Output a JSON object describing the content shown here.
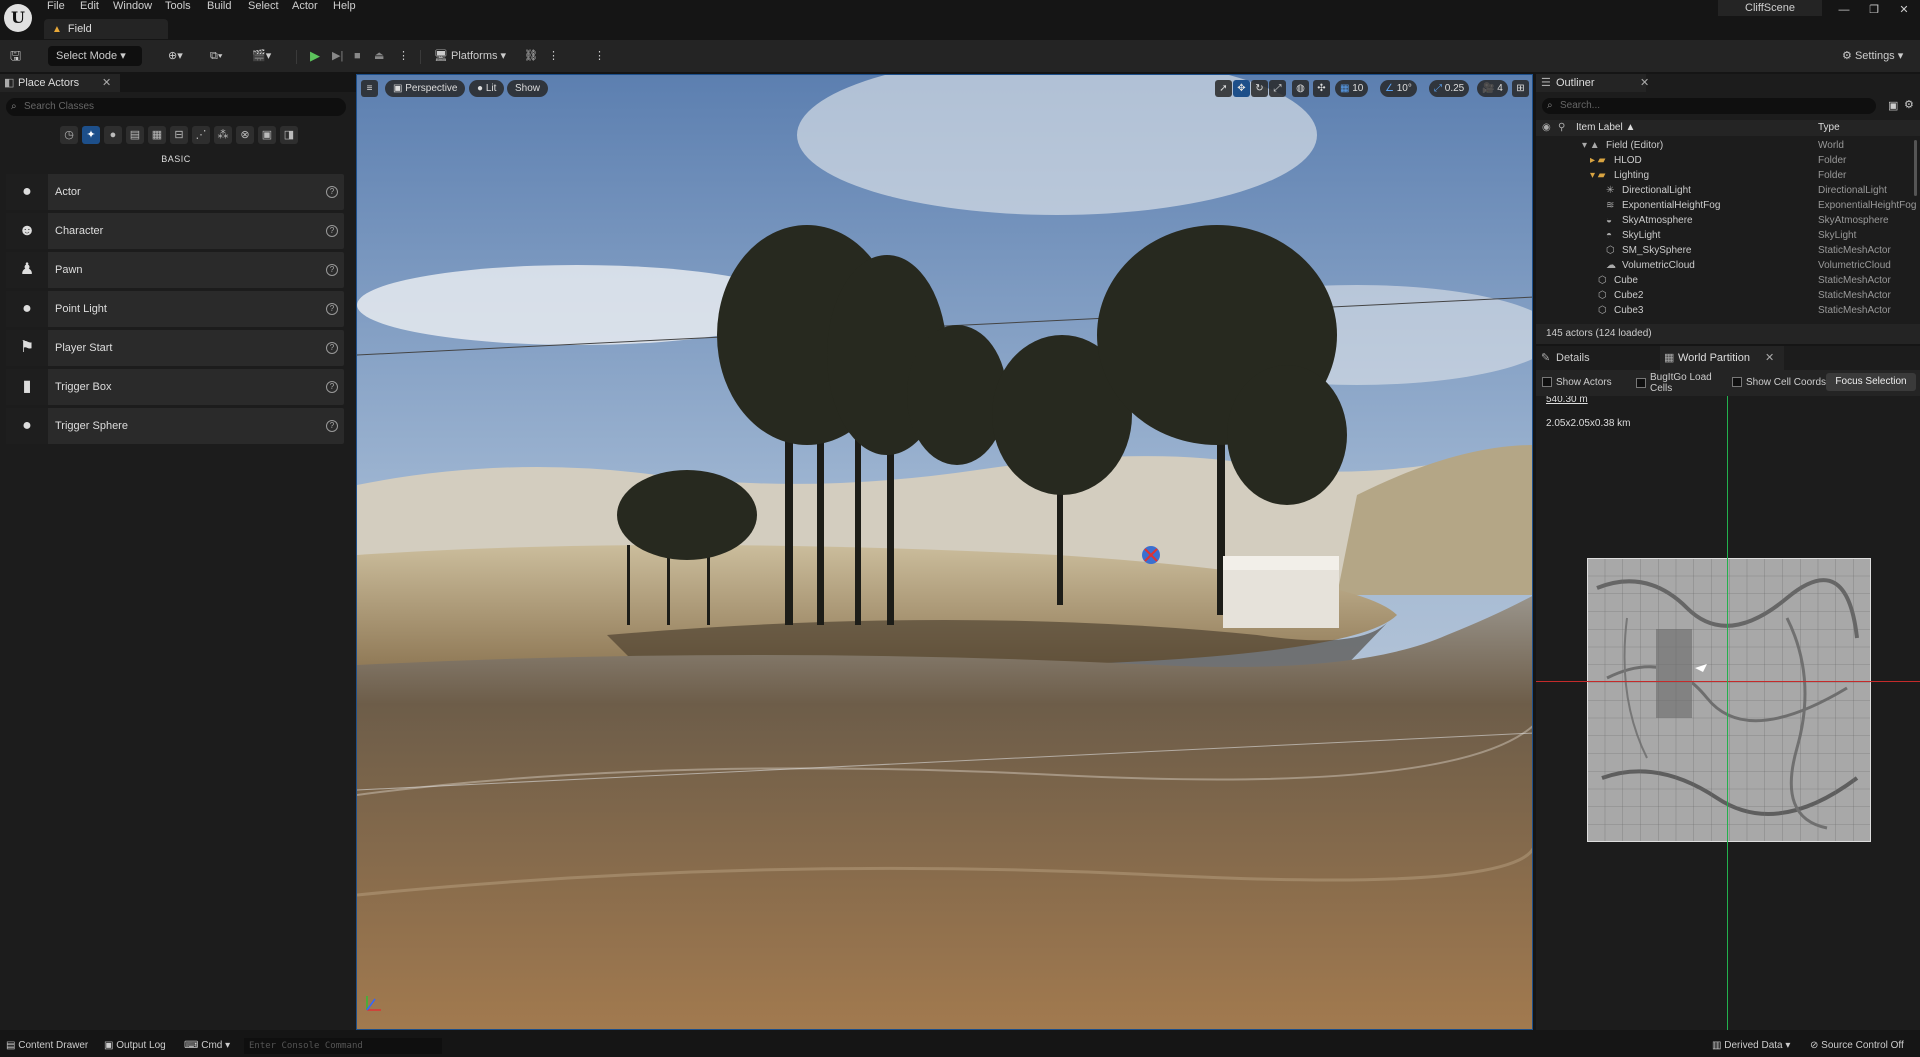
{
  "app": {
    "logo": "U",
    "menu": [
      "File",
      "Edit",
      "Window",
      "Tools",
      "Build",
      "Select",
      "Actor",
      "Help"
    ],
    "level_tab": "Field",
    "project_name": "CliffScene",
    "window_controls": [
      "minimize-icon",
      "maximize-icon",
      "close-icon"
    ]
  },
  "toolbar": {
    "save_icon": "save-icon",
    "select_mode": "Select Mode",
    "platforms": "Platforms",
    "settings": "Settings",
    "play_controls": [
      "play-icon",
      "step-icon",
      "stop-icon",
      "eject-icon"
    ]
  },
  "place_actors": {
    "tab_label": "Place Actors",
    "search_placeholder": "Search Classes",
    "section": "BASIC",
    "categories": [
      "recent-icon",
      "basic-icon",
      "lights-icon",
      "cinematic-icon",
      "visual-effects-icon",
      "geometry-icon",
      "volumes-icon",
      "all-classes-icon",
      "shapes-icon",
      "misc-icon",
      "blank-icon"
    ],
    "items": [
      {
        "label": "Actor",
        "icon": "actor-sphere-icon",
        "glyph": "●"
      },
      {
        "label": "Character",
        "icon": "character-icon",
        "glyph": "☻"
      },
      {
        "label": "Pawn",
        "icon": "pawn-icon",
        "glyph": "♟"
      },
      {
        "label": "Point Light",
        "icon": "light-bulb-icon",
        "glyph": "💡"
      },
      {
        "label": "Player Start",
        "icon": "flag-icon",
        "glyph": "⚑"
      },
      {
        "label": "Trigger Box",
        "icon": "trigger-box-icon",
        "glyph": "▮"
      },
      {
        "label": "Trigger Sphere",
        "icon": "trigger-sphere-icon",
        "glyph": "●"
      }
    ]
  },
  "viewport": {
    "perspective": "Perspective",
    "lit": "Lit",
    "show": "Show",
    "grid_snap": "10",
    "rotate_snap": "10°",
    "scale_snap": "0.25",
    "camera_speed": "4"
  },
  "outliner": {
    "tab_label": "Outliner",
    "search_placeholder": "Search...",
    "col_label": "Item Label ▲",
    "col_type": "Type",
    "rows": [
      {
        "label": "Field (Editor)",
        "type": "World",
        "indent": 0
      },
      {
        "label": "HLOD",
        "type": "Folder",
        "indent": 1
      },
      {
        "label": "Lighting",
        "type": "Folder",
        "indent": 1
      },
      {
        "label": "DirectionalLight",
        "type": "DirectionalLight",
        "indent": 2
      },
      {
        "label": "ExponentialHeightFog",
        "type": "ExponentialHeightFog",
        "indent": 2
      },
      {
        "label": "SkyAtmosphere",
        "type": "SkyAtmosphere",
        "indent": 2
      },
      {
        "label": "SkyLight",
        "type": "SkyLight",
        "indent": 2
      },
      {
        "label": "SM_SkySphere",
        "type": "StaticMeshActor",
        "indent": 2
      },
      {
        "label": "VolumetricCloud",
        "type": "VolumetricCloud",
        "indent": 2
      },
      {
        "label": "Cube",
        "type": "StaticMeshActor",
        "indent": 1
      },
      {
        "label": "Cube2",
        "type": "StaticMeshActor",
        "indent": 1
      },
      {
        "label": "Cube3",
        "type": "StaticMeshActor",
        "indent": 1
      }
    ],
    "footer": "145 actors (124 loaded)"
  },
  "details": {
    "details_tab": "Details",
    "world_partition_tab": "World Partition",
    "show_actors": "Show Actors",
    "bug_load_cells": "BugItGo Load Cells",
    "show_cell_coords": "Show Cell Coords",
    "focus_selection": "Focus Selection",
    "scale_label": "540.30 m",
    "world_size": "2.05x2.05x0.38 km"
  },
  "statusbar": {
    "content_drawer": "Content Drawer",
    "output_log": "Output Log",
    "cmd": "Cmd",
    "console_placeholder": "Enter Console Command",
    "derived_data": "Derived Data",
    "source_control": "Source Control Off"
  }
}
